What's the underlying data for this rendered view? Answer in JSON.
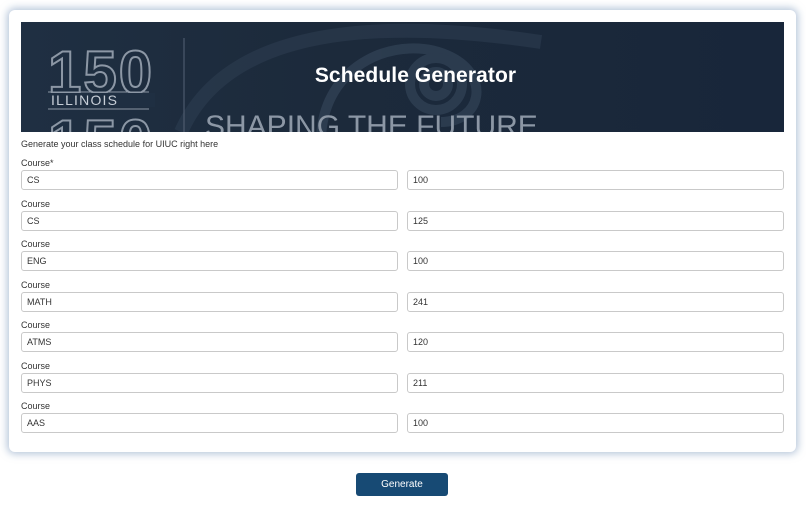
{
  "header": {
    "title": "Schedule Generator",
    "logo_number": "150",
    "logo_text": "ILLINOIS",
    "tagline": "SHAPING THE FUTURE"
  },
  "subtitle": "Generate your class schedule for UIUC right here",
  "courses": [
    {
      "label": "Course*",
      "subject": "CS",
      "number": "100"
    },
    {
      "label": "Course",
      "subject": "CS",
      "number": "125"
    },
    {
      "label": "Course",
      "subject": "ENG",
      "number": "100"
    },
    {
      "label": "Course",
      "subject": "MATH",
      "number": "241"
    },
    {
      "label": "Course",
      "subject": "ATMS",
      "number": "120"
    },
    {
      "label": "Course",
      "subject": "PHYS",
      "number": "211"
    },
    {
      "label": "Course",
      "subject": "AAS",
      "number": "100"
    }
  ],
  "generate_label": "Generate",
  "colors": {
    "banner": "#1c2a3b",
    "button": "#174a74",
    "card_glow": "#7896b9"
  }
}
